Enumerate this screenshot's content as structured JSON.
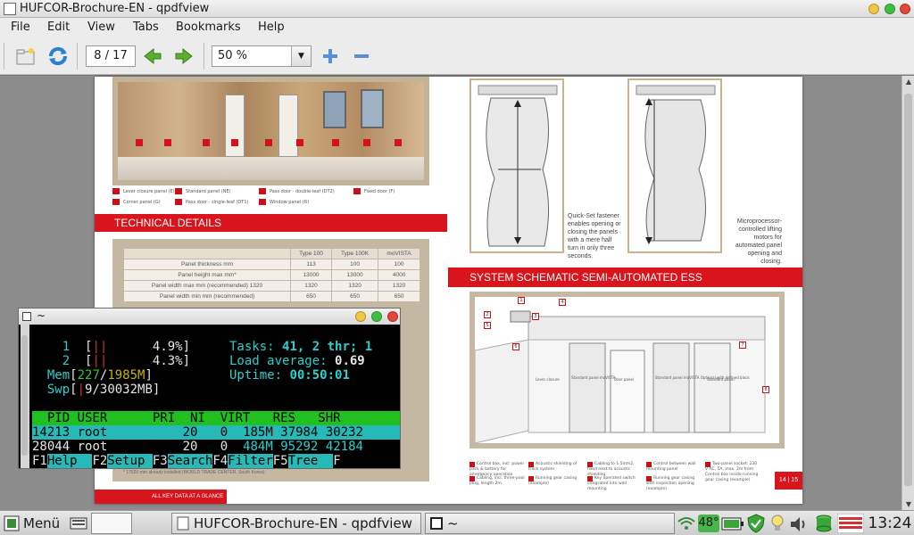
{
  "window": {
    "title": "HUFCOR-Brochure-EN - qpdfview"
  },
  "menu": {
    "file": "File",
    "edit": "Edit",
    "view": "View",
    "tabs": "Tabs",
    "bookmarks": "Bookmarks",
    "help": "Help"
  },
  "toolbar": {
    "page": "8 / 17",
    "zoom": "50 %"
  },
  "pdf": {
    "tech_banner": "TECHNICAL DETAILS",
    "schematic_banner": "SYSTEM SCHEMATIC SEMI-AUTOMATED ESS",
    "bottom_banner": "ALL KEY DATA AT A GLANCE",
    "page_numbers": "14 | 15",
    "legend": [
      "Lever closure panel (E)",
      "Standard panel (NE)",
      "Pass door - double-leaf (DT2)",
      "Fixed door (F)",
      "Corner panel (G)",
      "Pass door - single-leaf (DT1)",
      "Window panel (R)"
    ],
    "table": {
      "headers": [
        "",
        "Type 100",
        "Type 100K",
        "moVISTA"
      ],
      "rows": [
        [
          "Panel thickness mm",
          "113",
          "100",
          "100"
        ],
        [
          "Panel height max mm*",
          "13000",
          "13000",
          "4000"
        ],
        [
          "Panel width max mm (recommended) 1320",
          "1320",
          "1320",
          "1320"
        ],
        [
          "Panel width min mm (recommended)",
          "650",
          "650",
          "650"
        ]
      ]
    },
    "footnote": "* 17520 mm already installed (WORLD TRADE CENTER, South Korea)",
    "quickset_text": "Quick-Set fastener enables opening or closing the panels with a mere half turn in only three seconds.",
    "micro_text": "Microprocessor-controlled lifting motors for automated panel opening and closing.",
    "schematic_labels": [
      "Lever closure",
      "Standard panel moVISTA",
      "Door panel",
      "Standard panel moVISTA Optional with defined block",
      "Standard panel",
      "Overhead guide rail"
    ],
    "notes": [
      "Control box, incl. power pack & battery for emergency operation",
      "Acoustic shielding of track system",
      "Cabling to 1.5mm2, fixed next to acoustic shielding",
      "Control between wall mounting panel",
      "Two-panel socket: 230 V AC, 5A, max. 2m from Control box inside running gear casing (example)",
      "Cabling, incl. three-pool plug, length 2m",
      "Running gear casing (example)",
      "Key operated switch integrated into wall mounting",
      "Running gear casing with inspection opening (example)"
    ],
    "schematic_numbers": [
      "1",
      "2",
      "3",
      "4",
      "5",
      "6",
      "7",
      "8",
      "9"
    ]
  },
  "terminal": {
    "title": "~",
    "cpu": [
      {
        "num": "1",
        "bar": "||",
        "pct": "4.9%"
      },
      {
        "num": "2",
        "bar": "||",
        "pct": "4.3%"
      }
    ],
    "mem": {
      "label": "Mem",
      "used": "227",
      "sep": "/",
      "total": "1985M"
    },
    "swp": {
      "label": "Swp",
      "bar": "|",
      "val": "9/30032MB"
    },
    "tasks_label": "Tasks: ",
    "tasks_value": "41, 2 thr; 1",
    "load_label": "Load average: ",
    "load_value": "0.69",
    "uptime_label": "Uptime: ",
    "uptime_value": "00:50:01",
    "header": "  PID USER      PRI  NI  VIRT   RES   SHR",
    "rows": [
      {
        "pid": "14213",
        "user": "root",
        "pri": "20",
        "ni": "0",
        "virt": "185M",
        "res": "37984",
        "shr": "30232"
      },
      {
        "pid": "28044",
        "user": "root",
        "pri": "20",
        "ni": "0",
        "virt": "484M",
        "res": "95292",
        "shr": "42184"
      }
    ],
    "fkeys": [
      {
        "key": "F1",
        "label": "Help  "
      },
      {
        "key": "F2",
        "label": "Setup "
      },
      {
        "key": "F3",
        "label": "Search"
      },
      {
        "key": "F4",
        "label": "Filter"
      },
      {
        "key": "F5",
        "label": "Tree  "
      },
      {
        "key": "F",
        "label": ""
      }
    ]
  },
  "taskbar": {
    "menu_label": "Menü",
    "tasks": [
      "HUFCOR-Brochure-EN - qpdfview",
      "~"
    ],
    "temp": "48°",
    "clock": "13:24"
  },
  "colors": {
    "accent_red": "#d8141c",
    "terminal_cyan": "#2ad0d0",
    "terminal_green_bar": "#20c020"
  }
}
